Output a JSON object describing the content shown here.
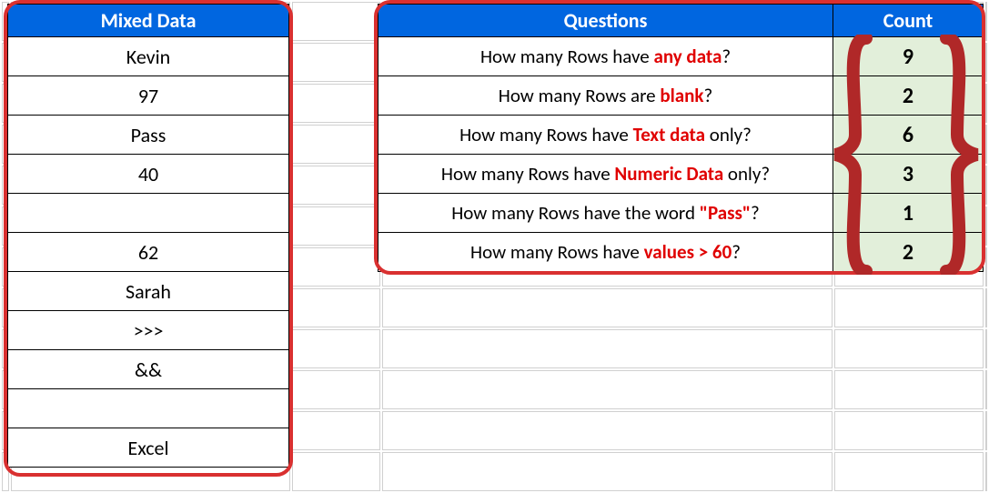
{
  "left": {
    "header": "Mixed Data",
    "rows": [
      "Kevin",
      "97",
      "Pass",
      "40",
      "",
      "62",
      "Sarah",
      ">>>",
      "&&",
      "",
      "Excel"
    ]
  },
  "right": {
    "qheader": "Questions",
    "cheader": "Count",
    "rows": [
      {
        "pre": "How many Rows have ",
        "em": "any data",
        "post": "?",
        "count": "9"
      },
      {
        "pre": "How many Rows are ",
        "em": "blank",
        "post": "?",
        "count": "2"
      },
      {
        "pre": "How many Rows have ",
        "em": "Text data",
        "post": " only?",
        "count": "6"
      },
      {
        "pre": "How many Rows have ",
        "em": "Numeric Data",
        "post": " only?",
        "count": "3"
      },
      {
        "pre": "How many Rows have the word ",
        "em": "\"Pass\"",
        "post": "?",
        "count": "1"
      },
      {
        "pre": "How many Rows have ",
        "em": "values > 60",
        "post": "?",
        "count": "2"
      }
    ]
  },
  "chart_data": {
    "type": "table",
    "left_table": {
      "header": "Mixed Data",
      "values": [
        "Kevin",
        97,
        "Pass",
        40,
        null,
        62,
        "Sarah",
        ">>>",
        "&&",
        null,
        "Excel"
      ]
    },
    "right_table": {
      "headers": [
        "Questions",
        "Count"
      ],
      "rows": [
        [
          "How many Rows have any data?",
          9
        ],
        [
          "How many Rows are blank?",
          2
        ],
        [
          "How many Rows have Text data only?",
          6
        ],
        [
          "How many Rows have Numeric Data only?",
          3
        ],
        [
          "How many Rows have the word \"Pass\"?",
          1
        ],
        [
          "How many Rows have values > 60?",
          2
        ]
      ]
    }
  }
}
